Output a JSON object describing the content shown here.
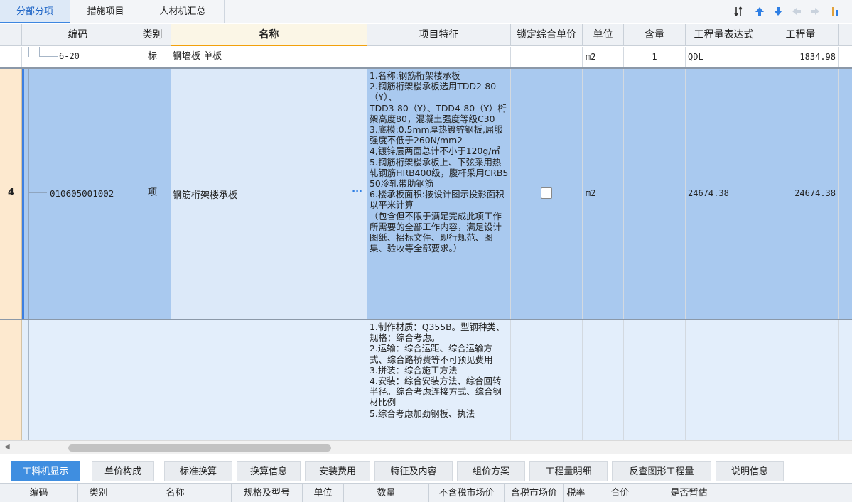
{
  "top_tabs": [
    {
      "label": "分部分项",
      "active": true
    },
    {
      "label": "措施项目",
      "active": false
    },
    {
      "label": "人材机汇总",
      "active": false
    }
  ],
  "colors": {
    "accent": "#3d86e0",
    "selected_row": "#a9c9ef",
    "rownum_bg": "#fde9cf"
  },
  "columns": [
    "编码",
    "类别",
    "名称",
    "项目特征",
    "锁定综合单价",
    "单位",
    "含量",
    "工程量表达式",
    "工程量"
  ],
  "rows": [
    {
      "code": "6-20",
      "type": "标",
      "name": "钢墙板 单板",
      "features": "",
      "locked": "",
      "unit": "m2",
      "qty_content": "1",
      "expr": "QDL",
      "quantity": "1834.98"
    },
    {
      "rownum": "4",
      "code": "010605001002",
      "type": "项",
      "name": "钢筋桁架楼承板",
      "more": "···",
      "features": "1.名称:钢筋桁架楼承板\n2.钢筋桁架楼承板选用TDD2-80（Y）、\nTDD3-80（Y）、TDD4-80（Y）桁架高度80，混凝土强度等级C30\n3.底模:0.5mm厚热镀锌钢板,屈服强度不低于260N/mm2\n4,镀锌层两面总计不小于120g/㎡\n5.钢筋桁架楼承板上、下弦采用热轧钢筋HRB400级，腹杆采用CRB550冷轧带肋钢筋\n6.楼承板面积:按设计图示投影面积以平米计算\n（包含但不限于满足完成此项工作所需要的全部工作内容，满足设计图纸、招标文件、现行规范、图集、验收等全部要求。）",
      "unit": "m2",
      "expr": "24674.38",
      "quantity": "24674.38"
    },
    {
      "features": "1.制作材质：Q355B。型钢种类、规格：综合考虑。\n2.运输：综合运距、综合运输方式、综合路桥费等不可预见费用\n3.拼装：综合施工方法\n4.安装：综合安装方法、综合回转半径。综合考虑连接方式、综合钢材比例\n5.综合考虑加劲钢板、执法"
    }
  ],
  "bottom_tabs": [
    {
      "label": "工料机显示",
      "active": true
    },
    {
      "label": "单价构成",
      "active": false
    },
    {
      "label": "标准换算",
      "active": false
    },
    {
      "label": "换算信息",
      "active": false
    },
    {
      "label": "安装费用",
      "active": false
    },
    {
      "label": "特征及内容",
      "active": false
    },
    {
      "label": "组价方案",
      "active": false
    },
    {
      "label": "工程量明细",
      "active": false
    },
    {
      "label": "反查图形工程量",
      "active": false
    },
    {
      "label": "说明信息",
      "active": false
    }
  ],
  "bottom_columns": [
    "编码",
    "类别",
    "名称",
    "规格及型号",
    "单位",
    "数量",
    "不含税市场价",
    "含税市场价",
    "税率",
    "合价",
    "是否暂估"
  ]
}
